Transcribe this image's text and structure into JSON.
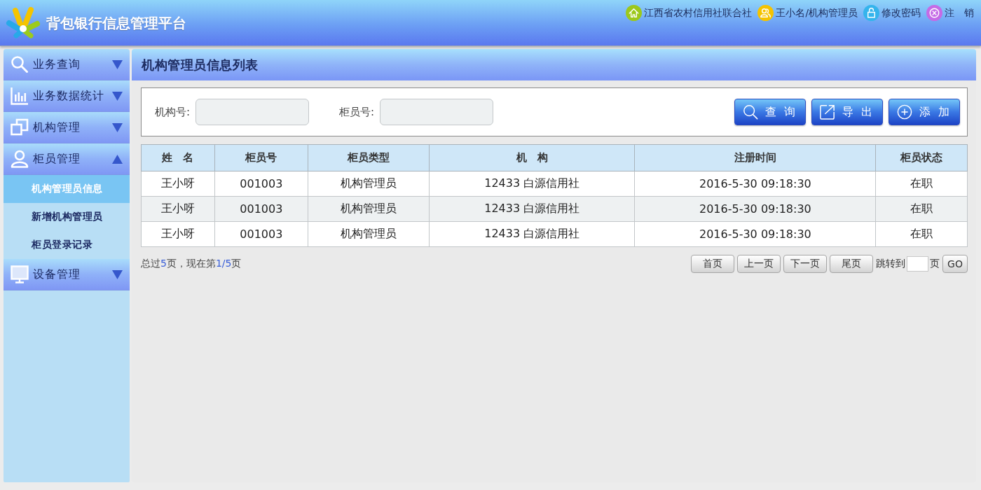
{
  "header": {
    "title": "背包银行信息管理平台",
    "links": [
      {
        "kind": "home",
        "text": "江西省农村信用社联合社"
      },
      {
        "kind": "user",
        "text": "王小名/机构管理员"
      },
      {
        "kind": "lock",
        "text": "修改密码"
      },
      {
        "kind": "logout",
        "text": "注　销"
      }
    ]
  },
  "sidebar": {
    "items": [
      {
        "kind": "search",
        "label": "业务查询",
        "expanded": false
      },
      {
        "kind": "chart",
        "label": "业务数据统计",
        "expanded": false
      },
      {
        "kind": "windows",
        "label": "机构管理",
        "expanded": false
      },
      {
        "kind": "user",
        "label": "柜员管理",
        "expanded": true,
        "children": [
          {
            "label": "机构管理员信息",
            "selected": true
          },
          {
            "label": "新增机构管理员",
            "selected": false
          },
          {
            "label": "柜员登录记录",
            "selected": false
          }
        ]
      },
      {
        "kind": "monitor",
        "label": "设备管理",
        "expanded": false
      }
    ]
  },
  "panel": {
    "title": "机构管理员信息列表",
    "filters": [
      {
        "label": "机构号:"
      },
      {
        "label": "柜员号:"
      }
    ],
    "buttons": [
      {
        "kind": "search",
        "label": "查 询"
      },
      {
        "kind": "export",
        "label": "导 出"
      },
      {
        "kind": "add",
        "label": "添 加"
      }
    ]
  },
  "table": {
    "columns": [
      "姓　名",
      "柜员号",
      "柜员类型",
      "机　构",
      "注册时间",
      "柜员状态"
    ],
    "rows": [
      [
        "王小呀",
        "001003",
        "机构管理员",
        "12433 白源信用社",
        "2016-5-30 09:18:30",
        "在职"
      ],
      [
        "王小呀",
        "001003",
        "机构管理员",
        "12433 白源信用社",
        "2016-5-30 09:18:30",
        "在职"
      ],
      [
        "王小呀",
        "001003",
        "机构管理员",
        "12433 白源信用社",
        "2016-5-30 09:18:30",
        "在职"
      ]
    ]
  },
  "pagination": {
    "summary": [
      {
        "text": "总过",
        "highlight": false
      },
      {
        "text": "5",
        "highlight": true
      },
      {
        "text": "页，现在第",
        "highlight": false
      },
      {
        "text": "1/5",
        "highlight": true
      },
      {
        "text": "页",
        "highlight": false
      }
    ],
    "buttons": [
      "首页",
      "上一页",
      "下一页",
      "尾页"
    ],
    "jump_label": "跳转到",
    "jump_suffix": "页",
    "go": "GO"
  }
}
